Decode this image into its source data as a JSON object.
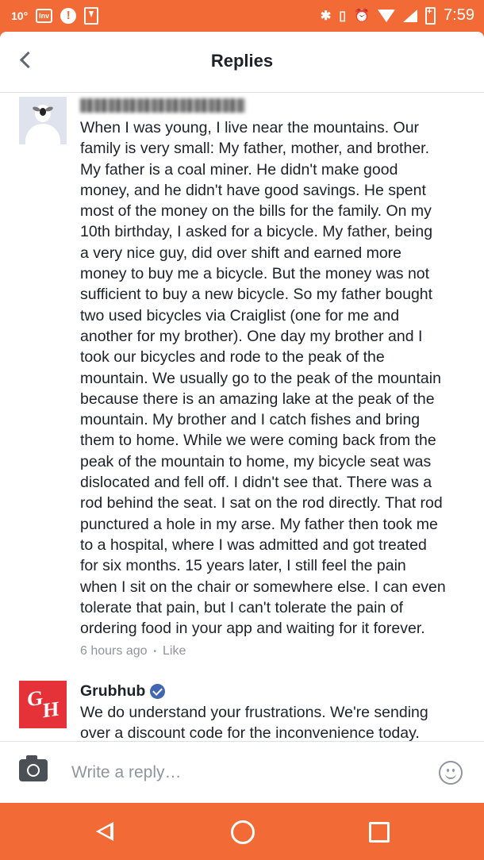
{
  "status_bar": {
    "temperature": "10°",
    "notification_badge": "Inv",
    "alert_glyph": "!",
    "bluetooth_glyph": "✱",
    "vibrate_glyph": "▯",
    "alarm_glyph": "⏰",
    "time": "7:59",
    "accent_color": "#f26b36"
  },
  "header": {
    "title": "Replies"
  },
  "comment": {
    "text": "When I was young,  I live near the mountains. Our\nfamily is very small: My father, mother, and brother.\nMy father is a coal miner. He didn't make good\nmoney, and he didn't have good savings. He spent\nmost of the money on the bills for the family. On my\n10th birthday, I asked for a bicycle. My father, being\na very nice guy, did over shift and earned more\nmoney to buy me a bicycle. But the money was not\nsufficient to buy a new bicycle. So my father bought\ntwo used bicycles via Craiglist (one for me and\nanother for my brother). One day my brother and I\ntook our bicycles and rode to the peak of the\nmountain. We usually go to the peak of the mountain\nbecause there is an amazing lake at the peak of the\nmountain. My brother and I catch fishes and bring\nthem to home. While we were coming back from the\npeak of the mountain to home, my bicycle seat was\ndislocated and fell off. I didn't see that. There was a\nrod behind the seat. I sat on the rod directly. That rod\npunctured a hole in my arse. My father then took me\nto a hospital, where I was admitted and got treated\nfor six months. 15 years later, I still feel the pain\nwhen I sit on the chair or somewhere else. I can even\ntolerate that pain, but I can't tolerate the pain of\nordering food in your app and waiting for it forever.",
    "timestamp": "6 hours ago",
    "separator": "•",
    "like_label": "Like"
  },
  "reply": {
    "author": "Grubhub",
    "avatar_letters": [
      "G",
      "H"
    ],
    "verified": true,
    "text": "We do understand your frustrations. We're sending\nover a discount code for the inconvenience today.",
    "brand_color": "#e53238"
  },
  "composer": {
    "placeholder": "Write a reply…"
  },
  "icons": [
    "back-icon",
    "camera-icon",
    "emoji-icon",
    "verified-icon",
    "nav-back-icon",
    "nav-home-icon",
    "nav-recents-icon"
  ]
}
